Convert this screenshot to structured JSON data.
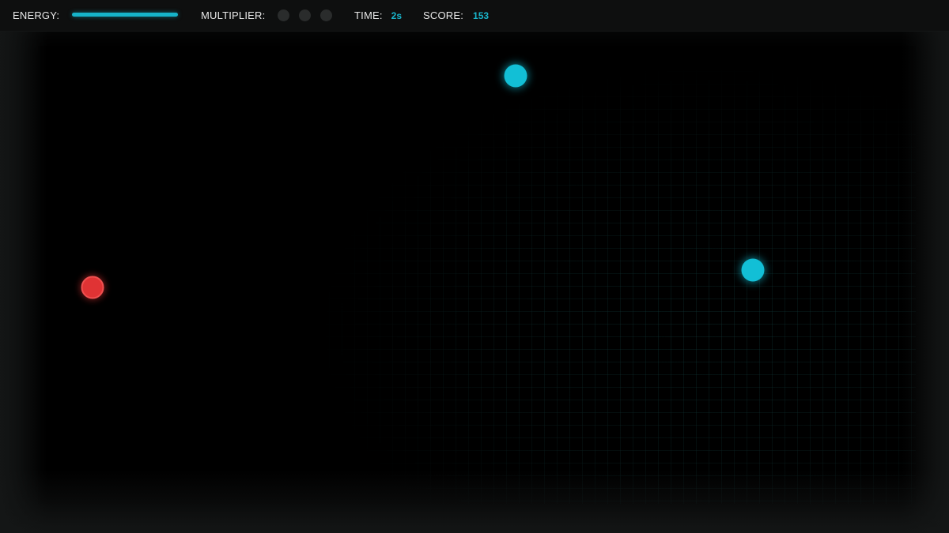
{
  "hud": {
    "energy_label": "ENERGY:",
    "energy_level": 1.0,
    "multiplier_label": "MULTIPLIER:",
    "multiplier_slots": 3,
    "multiplier_active": 0,
    "time_label": "TIME:",
    "time_value": "2s",
    "score_label": "SCORE:",
    "score_value": "153"
  },
  "colors": {
    "accent": "#12bfd6",
    "enemy": "#e03334",
    "background": "#000000",
    "inactive_dot": "#2a2c2c"
  },
  "entities": [
    {
      "kind": "player-orb",
      "color": "red"
    },
    {
      "kind": "energy-orb",
      "color": "cyan"
    },
    {
      "kind": "energy-orb",
      "color": "cyan"
    }
  ]
}
